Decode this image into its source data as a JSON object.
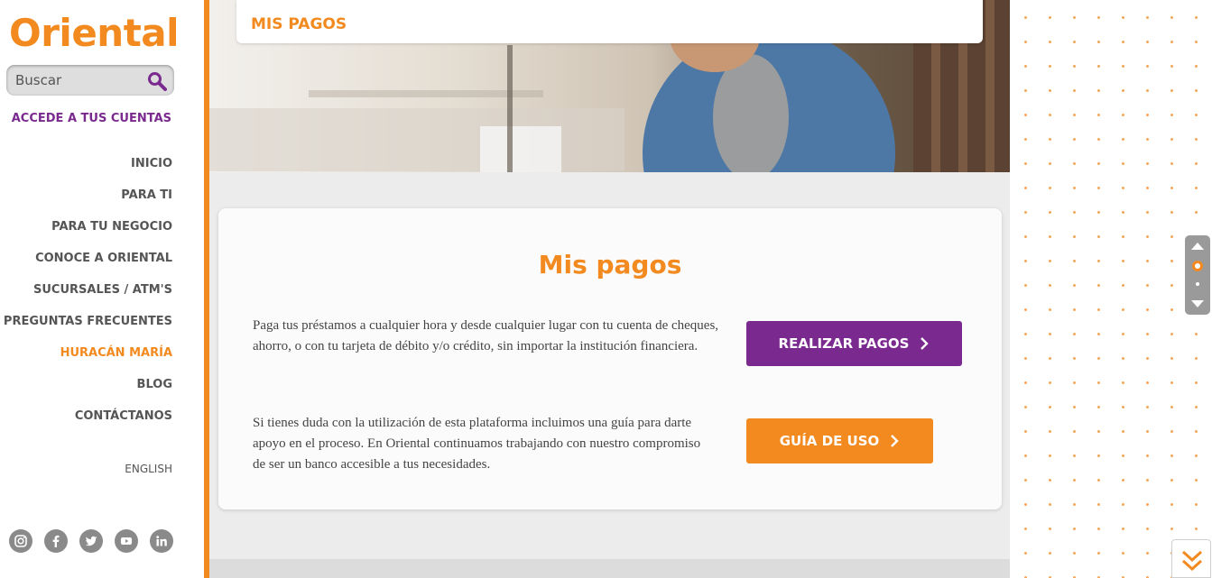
{
  "brand": {
    "logo": "Oriental",
    "accent": "#f28a1f",
    "purple": "#7a2a8e"
  },
  "search": {
    "placeholder": "Buscar",
    "icon": "search-icon"
  },
  "sidebar": {
    "accede": "ACCEDE A TUS CUENTAS",
    "items": [
      {
        "label": "INICIO"
      },
      {
        "label": "PARA TI"
      },
      {
        "label": "PARA TU NEGOCIO"
      },
      {
        "label": "CONOCE A ORIENTAL"
      },
      {
        "label": "SUCURSALES / ATM'S"
      },
      {
        "label": "PREGUNTAS FRECUENTES"
      },
      {
        "label": "HURACÁN MARÍA"
      },
      {
        "label": "BLOG"
      },
      {
        "label": "CONTÁCTANOS"
      }
    ],
    "language": "ENGLISH",
    "social": [
      "instagram-icon",
      "facebook-icon",
      "twitter-icon",
      "youtube-icon",
      "linkedin-icon"
    ]
  },
  "hero": {
    "tab_title": "MIS PAGOS"
  },
  "card": {
    "title": "Mis pagos",
    "paragraph1": "Paga tus préstamos a cualquier hora y desde cualquier lugar con tu cuenta de cheques, ahorro, o con tu tarjeta de débito y/o crédito, sin importar la institución financiera.",
    "button1": "REALIZAR PAGOS",
    "paragraph2": "Si tienes duda con la utilización de esta plataforma incluimos una guía para darte apoyo en el proceso. En Oriental continuamos trabajando con nuestro compromiso de ser un banco accesible a tus necesidades.",
    "button2": "GUÍA DE USO"
  }
}
